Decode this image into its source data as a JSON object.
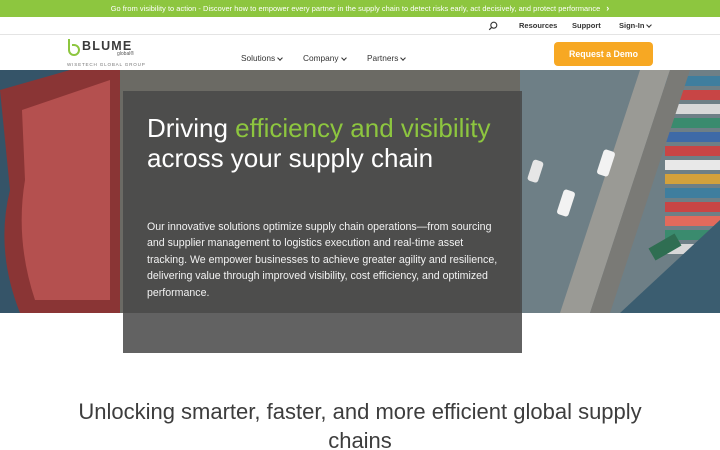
{
  "announcement": {
    "text": "Go from visibility to action - Discover how to empower every partner in the supply chain to detect risks early, act decisively, and protect performance",
    "arrow": "›"
  },
  "utility_nav": {
    "resources": "Resources",
    "support": "Support",
    "signin": "Sign-In"
  },
  "logo": {
    "wordmark": "BLUME",
    "global": "global®",
    "tagline": "WISETECH GLOBAL GROUP"
  },
  "main_nav": {
    "items": [
      {
        "label": "Solutions"
      },
      {
        "label": "Company"
      },
      {
        "label": "Partners"
      }
    ],
    "cta": "Request a Demo"
  },
  "hero": {
    "headline_1": "Driving ",
    "headline_hl_1": "efficiency and visibility",
    "headline_2": " across your supply chain",
    "description": "Our innovative solutions optimize supply chain operations—from sourcing and supplier management to logistics execution and real-time asset tracking. We empower businesses to achieve greater agility and resilience, delivering value through improved visibility, cost efficiency, and optimized performance."
  },
  "section": {
    "title": "Unlocking smarter, faster, and more efficient global supply chains"
  },
  "colors": {
    "brand_green": "#8dc63f",
    "cta_orange": "#f7a823",
    "text_dark": "#3a3a3a"
  }
}
